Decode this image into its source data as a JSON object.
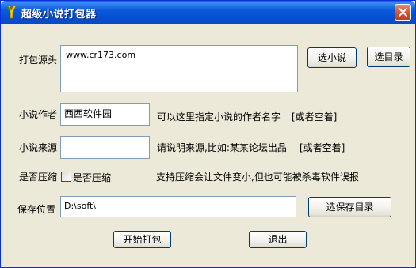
{
  "window": {
    "title": "超级小说打包器"
  },
  "form": {
    "source": {
      "label": "打包源头",
      "value": "www.cr173.com",
      "select_novel_button": "选小说",
      "select_dir_button": "选目录"
    },
    "author": {
      "label": "小说作者",
      "value": "西西软件园",
      "hint": "可以这里指定小说的作者名字",
      "hint_optional": "[或者空着]"
    },
    "origin": {
      "label": "小说来源",
      "value": "",
      "hint": "请说明来源,比如:某某论坛出品",
      "hint_optional": "[或者空着]"
    },
    "compress": {
      "label": "是否压缩",
      "checkbox_label": "是否压缩",
      "checked": false,
      "hint": "支持压缩会让文件变小,但也可能被杀毒软件误报"
    },
    "save": {
      "label": "保存位置",
      "value": "D:\\soft\\",
      "select_dir_button": "选保存目录"
    }
  },
  "actions": {
    "start_button": "开始打包",
    "exit_button": "退出"
  }
}
